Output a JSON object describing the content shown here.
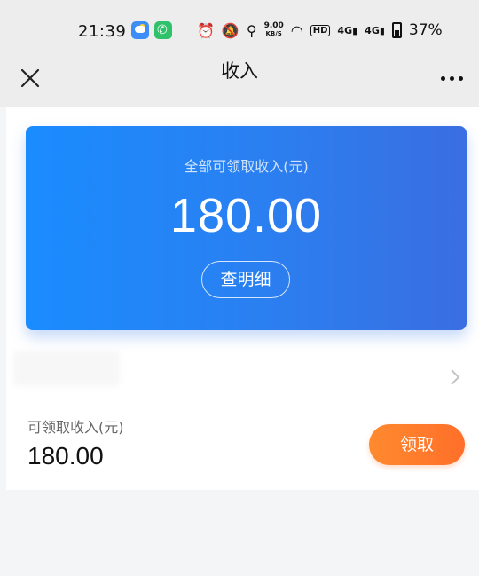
{
  "status_bar": {
    "time": "21:39",
    "network_speed_value": "9.00",
    "network_speed_unit": "KB/S",
    "hd_label": "HD",
    "signal_label_1": "4G",
    "signal_label_2": "4G",
    "battery_percent": "37%"
  },
  "navbar": {
    "title": "收入"
  },
  "summary_card": {
    "label": "全部可领取收入(元)",
    "amount": "180.00",
    "detail_button_label": "查明细"
  },
  "claim_section": {
    "label": "可领取收入(元)",
    "amount": "180.00",
    "claim_button_label": "领取"
  },
  "colors": {
    "card_gradient_start": "#1a8cff",
    "card_gradient_end": "#3a6ee2",
    "claim_button": "#ff7a2c"
  }
}
